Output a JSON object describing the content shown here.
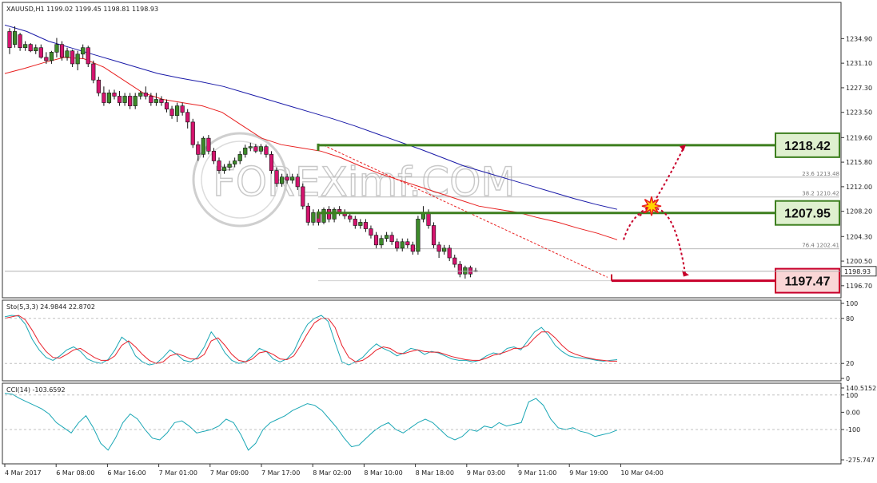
{
  "chart_data": [
    {
      "type": "candlestick",
      "title": "XAUUSD,H1  1199.02 1199.45 1198.81 1198.93",
      "ylim": [
        1195.2,
        1238.4
      ],
      "y_ticks": [
        "1234.90",
        "1231.10",
        "1227.30",
        "1223.50",
        "1219.60",
        "1215.80",
        "1212.00",
        "1208.20",
        "1204.30",
        "1200.50",
        "1196.70"
      ],
      "y_tick_values": [
        1234.9,
        1231.1,
        1227.3,
        1223.5,
        1219.6,
        1215.8,
        1212.0,
        1208.2,
        1204.3,
        1200.5,
        1196.7
      ],
      "current_price": "1198.93",
      "current_price_value": 1198.93,
      "x_ticks": [
        "4 Mar 2017",
        "6 Mar 08:00",
        "6 Mar 16:00",
        "7 Mar 01:00",
        "7 Mar 09:00",
        "7 Mar 17:00",
        "8 Mar 02:00",
        "8 Mar 10:00",
        "8 Mar 18:00",
        "9 Mar 03:00",
        "9 Mar 11:00",
        "9 Mar 19:00",
        "10 Mar 04:00"
      ],
      "candles": [
        [
          1236.0,
          1236.5,
          1232.5,
          1233.5
        ],
        [
          1234.0,
          1236.8,
          1233.5,
          1236.0
        ],
        [
          1235.5,
          1235.8,
          1233.0,
          1233.5
        ],
        [
          1233.5,
          1234.5,
          1233.0,
          1234.0
        ],
        [
          1234.0,
          1234.2,
          1232.8,
          1233.0
        ],
        [
          1233.0,
          1234.0,
          1232.5,
          1233.5
        ],
        [
          1233.5,
          1234.0,
          1231.8,
          1232.0
        ],
        [
          1232.0,
          1232.8,
          1231.0,
          1231.5
        ],
        [
          1231.5,
          1233.0,
          1231.0,
          1232.8
        ],
        [
          1232.8,
          1235.0,
          1232.0,
          1234.0
        ],
        [
          1234.0,
          1234.5,
          1231.5,
          1232.0
        ],
        [
          1232.0,
          1233.5,
          1231.5,
          1233.0
        ],
        [
          1233.0,
          1233.2,
          1230.5,
          1231.0
        ],
        [
          1231.0,
          1233.0,
          1230.0,
          1232.5
        ],
        [
          1232.5,
          1234.0,
          1231.8,
          1233.5
        ],
        [
          1233.5,
          1233.8,
          1230.5,
          1231.0
        ],
        [
          1231.0,
          1231.5,
          1228.0,
          1228.5
        ],
        [
          1228.5,
          1229.0,
          1226.0,
          1226.5
        ],
        [
          1226.5,
          1227.5,
          1224.5,
          1225.0
        ],
        [
          1225.0,
          1227.0,
          1224.8,
          1226.5
        ],
        [
          1226.5,
          1227.0,
          1225.5,
          1226.0
        ],
        [
          1226.0,
          1226.8,
          1224.5,
          1225.0
        ],
        [
          1225.0,
          1226.5,
          1224.5,
          1226.0
        ],
        [
          1226.0,
          1226.5,
          1224.0,
          1224.5
        ],
        [
          1224.5,
          1226.5,
          1224.0,
          1226.0
        ],
        [
          1226.0,
          1226.8,
          1225.5,
          1226.5
        ],
        [
          1226.5,
          1227.5,
          1225.5,
          1226.0
        ],
        [
          1226.0,
          1226.5,
          1224.5,
          1225.0
        ],
        [
          1225.0,
          1226.5,
          1224.5,
          1225.5
        ],
        [
          1225.5,
          1226.0,
          1224.5,
          1225.0
        ],
        [
          1225.0,
          1225.5,
          1223.5,
          1224.0
        ],
        [
          1224.0,
          1224.5,
          1222.5,
          1223.0
        ],
        [
          1223.0,
          1225.0,
          1222.0,
          1224.5
        ],
        [
          1224.5,
          1225.0,
          1223.0,
          1223.5
        ],
        [
          1223.5,
          1224.0,
          1221.0,
          1222.0
        ],
        [
          1222.0,
          1222.5,
          1218.0,
          1218.5
        ],
        [
          1218.5,
          1219.0,
          1216.0,
          1217.0
        ],
        [
          1217.0,
          1219.8,
          1216.5,
          1219.5
        ],
        [
          1219.5,
          1220.0,
          1217.0,
          1217.5
        ],
        [
          1217.5,
          1218.0,
          1215.5,
          1216.0
        ],
        [
          1216.0,
          1216.5,
          1214.0,
          1214.5
        ],
        [
          1214.5,
          1215.5,
          1214.0,
          1215.0
        ],
        [
          1215.0,
          1216.0,
          1214.5,
          1215.5
        ],
        [
          1215.5,
          1216.5,
          1215.0,
          1216.0
        ],
        [
          1216.0,
          1217.5,
          1215.5,
          1217.0
        ],
        [
          1217.0,
          1218.5,
          1216.5,
          1218.0
        ],
        [
          1218.0,
          1218.8,
          1217.5,
          1218.2
        ],
        [
          1218.2,
          1218.6,
          1217.2,
          1217.5
        ],
        [
          1217.5,
          1218.6,
          1217.0,
          1218.2
        ],
        [
          1218.2,
          1218.5,
          1216.5,
          1217.0
        ],
        [
          1217.0,
          1217.5,
          1214.0,
          1214.5
        ],
        [
          1214.5,
          1215.0,
          1212.0,
          1212.5
        ],
        [
          1212.5,
          1214.0,
          1212.0,
          1213.5
        ],
        [
          1213.5,
          1214.0,
          1212.5,
          1213.0
        ],
        [
          1213.0,
          1214.0,
          1212.5,
          1213.5
        ],
        [
          1213.5,
          1214.0,
          1211.5,
          1212.0
        ],
        [
          1212.0,
          1212.5,
          1208.5,
          1209.0
        ],
        [
          1209.0,
          1209.5,
          1206.0,
          1206.5
        ],
        [
          1206.5,
          1208.5,
          1206.0,
          1208.0
        ],
        [
          1208.0,
          1208.5,
          1206.0,
          1206.5
        ],
        [
          1206.5,
          1208.8,
          1206.2,
          1208.5
        ],
        [
          1208.5,
          1209.0,
          1206.5,
          1207.0
        ],
        [
          1207.0,
          1208.8,
          1206.5,
          1208.5
        ],
        [
          1208.5,
          1209.0,
          1207.5,
          1208.0
        ],
        [
          1208.0,
          1208.5,
          1207.0,
          1207.5
        ],
        [
          1207.5,
          1208.0,
          1206.5,
          1207.0
        ],
        [
          1207.0,
          1207.5,
          1205.5,
          1206.0
        ],
        [
          1206.0,
          1207.0,
          1205.5,
          1206.5
        ],
        [
          1206.5,
          1207.0,
          1205.0,
          1205.5
        ],
        [
          1205.5,
          1206.0,
          1204.0,
          1204.5
        ],
        [
          1204.5,
          1205.0,
          1202.5,
          1203.0
        ],
        [
          1203.0,
          1204.5,
          1202.5,
          1204.0
        ],
        [
          1204.0,
          1205.0,
          1203.5,
          1204.5
        ],
        [
          1204.5,
          1205.0,
          1203.0,
          1203.5
        ],
        [
          1203.5,
          1204.0,
          1202.0,
          1202.5
        ],
        [
          1202.5,
          1204.0,
          1202.0,
          1203.5
        ],
        [
          1203.5,
          1204.0,
          1202.5,
          1203.0
        ],
        [
          1203.0,
          1203.5,
          1201.5,
          1202.0
        ],
        [
          1202.0,
          1207.5,
          1201.5,
          1207.0
        ],
        [
          1207.0,
          1209.0,
          1206.5,
          1208.0
        ],
        [
          1208.0,
          1208.5,
          1205.5,
          1206.0
        ],
        [
          1206.0,
          1206.5,
          1202.5,
          1203.0
        ],
        [
          1203.0,
          1203.5,
          1201.0,
          1202.0
        ],
        [
          1202.0,
          1203.0,
          1201.5,
          1202.5
        ],
        [
          1202.5,
          1203.0,
          1200.5,
          1201.0
        ],
        [
          1201.0,
          1201.5,
          1199.5,
          1200.0
        ],
        [
          1200.0,
          1200.5,
          1198.0,
          1198.5
        ],
        [
          1198.5,
          1199.8,
          1197.8,
          1199.5
        ],
        [
          1199.5,
          1199.8,
          1198.0,
          1198.5
        ],
        [
          1199.02,
          1199.45,
          1198.81,
          1198.93
        ]
      ],
      "ma_slow": [
        1237,
        1236,
        1234.5,
        1233.5,
        1232.5,
        1231.5,
        1230.5,
        1229.5,
        1228.8,
        1228.2,
        1227.5,
        1226.5,
        1225.5,
        1224.5,
        1223.5,
        1222.5,
        1221.4,
        1220.2,
        1219,
        1217.8,
        1216.5,
        1215.2,
        1214.2,
        1213.2,
        1212.2,
        1211.2,
        1210.2,
        1209.3,
        1208.5
      ],
      "ma_fast": [
        1229.5,
        1230.3,
        1231.2,
        1232,
        1231.8,
        1230.5,
        1228.5,
        1226.5,
        1225.5,
        1225,
        1224.5,
        1223.5,
        1221.5,
        1219.5,
        1218.5,
        1218,
        1217.5,
        1216.5,
        1215.2,
        1214,
        1213,
        1212,
        1211,
        1210,
        1209,
        1208.5,
        1208,
        1207.2,
        1206.5,
        1205.6,
        1204.8,
        1203.8
      ],
      "fib_levels": [
        {
          "label": "23.6 1213.48",
          "value": 1213.48
        },
        {
          "label": "38.2 1210.42",
          "value": 1210.42
        },
        {
          "label": "76.4 1202.41",
          "value": 1202.41
        }
      ],
      "levels": [
        {
          "label": "1218.42",
          "value": 1218.42,
          "color": "#3d7f1f"
        },
        {
          "label": "1207.95",
          "value": 1207.95,
          "color": "#3d7f1f"
        },
        {
          "label": "1197.47",
          "value": 1197.47,
          "color": "#c8002b"
        }
      ],
      "watermark": "FOREXimf.COM"
    },
    {
      "type": "line",
      "title": "Sto(5,3,3) 24.9844 22.8702",
      "ylim": [
        0,
        100
      ],
      "y_ticks": [
        "100",
        "80",
        "20",
        "0"
      ],
      "y_tick_values": [
        100,
        80,
        20,
        0
      ],
      "series": [
        {
          "color": "#1aa7b5",
          "values": [
            82,
            84,
            83,
            72,
            52,
            38,
            28,
            24,
            30,
            38,
            42,
            36,
            26,
            22,
            20,
            25,
            38,
            55,
            48,
            30,
            22,
            18,
            20,
            28,
            38,
            32,
            24,
            22,
            28,
            42,
            62,
            50,
            34,
            24,
            20,
            22,
            30,
            40,
            36,
            26,
            22,
            26,
            36,
            56,
            72,
            80,
            84,
            76,
            48,
            22,
            18,
            22,
            28,
            38,
            46,
            40,
            36,
            30,
            34,
            40,
            38,
            32,
            36,
            34,
            30,
            26,
            24,
            24,
            22,
            24,
            30,
            34,
            32,
            40,
            42,
            38,
            50,
            62,
            68,
            58,
            44,
            36,
            30,
            28,
            27,
            26,
            24,
            23,
            24,
            25
          ]
        },
        {
          "color": "#e8202a",
          "values": [
            80,
            82,
            84,
            78,
            64,
            48,
            36,
            28,
            27,
            32,
            38,
            40,
            34,
            28,
            24,
            24,
            30,
            44,
            50,
            42,
            32,
            24,
            20,
            22,
            30,
            33,
            30,
            26,
            26,
            32,
            50,
            54,
            44,
            32,
            24,
            22,
            26,
            34,
            36,
            32,
            26,
            25,
            30,
            44,
            60,
            74,
            80,
            80,
            68,
            44,
            28,
            22,
            24,
            30,
            38,
            42,
            40,
            34,
            33,
            36,
            38,
            36,
            35,
            35,
            32,
            29,
            27,
            25,
            24,
            24,
            27,
            31,
            33,
            36,
            40,
            40,
            44,
            54,
            62,
            62,
            54,
            44,
            36,
            32,
            29,
            27,
            25,
            24,
            23,
            23
          ]
        }
      ]
    },
    {
      "type": "line",
      "title": "CCI(14) -103.6592",
      "ylim": [
        -275.747,
        140.5152
      ],
      "y_ticks": [
        "140.5152",
        "100",
        "0.00",
        "-100",
        "-275.747"
      ],
      "y_tick_values": [
        140.5152,
        100,
        0,
        -100,
        -275.747
      ],
      "series": [
        {
          "color": "#1aa7b5",
          "values": [
            110,
            105,
            80,
            60,
            40,
            20,
            -10,
            -60,
            -90,
            -120,
            -60,
            -20,
            -90,
            -180,
            -220,
            -150,
            -60,
            -10,
            -40,
            -100,
            -150,
            -160,
            -120,
            -60,
            -50,
            -80,
            -120,
            -110,
            -100,
            -80,
            -40,
            -60,
            -130,
            -220,
            -180,
            -100,
            -60,
            -40,
            -20,
            10,
            30,
            50,
            40,
            10,
            -40,
            -90,
            -150,
            -200,
            -190,
            -150,
            -110,
            -80,
            -60,
            -100,
            -120,
            -90,
            -60,
            -40,
            -60,
            -100,
            -140,
            -160,
            -140,
            -100,
            -110,
            -80,
            -90,
            -60,
            -80,
            -70,
            -60,
            60,
            80,
            40,
            -40,
            -90,
            -100,
            -90,
            -110,
            -120,
            -140,
            -130,
            -120,
            -103
          ]
        }
      ]
    }
  ]
}
